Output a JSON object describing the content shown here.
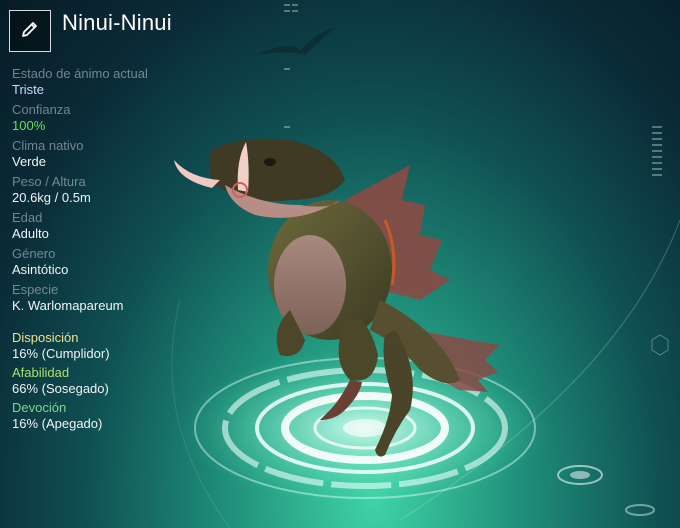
{
  "creature": {
    "name": "Ninui-Ninui"
  },
  "edit_icon": "pencil-icon",
  "stats": [
    {
      "label": "Estado de ánimo actual",
      "value": "Triste"
    },
    {
      "label": "Confianza",
      "value": "100%"
    },
    {
      "label": "Clima nativo",
      "value": "Verde"
    },
    {
      "label": "Peso / Altura",
      "value": "20.6kg / 0.5m"
    },
    {
      "label": "Edad",
      "value": "Adulto"
    },
    {
      "label": "Género",
      "value": "Asintótico"
    },
    {
      "label": "Especie",
      "value": "K. Warlomapareum"
    }
  ],
  "traits": [
    {
      "label": "Disposición",
      "value": "16% (Cumplidor)"
    },
    {
      "label": "Afabilidad",
      "value": "66% (Sosegado)"
    },
    {
      "label": "Devoción",
      "value": "16% (Apegado)"
    }
  ],
  "colors": {
    "mood_value": "#c9d8ff",
    "trust_value": "#66e35a",
    "disposition_label": "#f2e08a",
    "affability_label": "#a9e06e",
    "devotion_label": "#7cda8e"
  }
}
